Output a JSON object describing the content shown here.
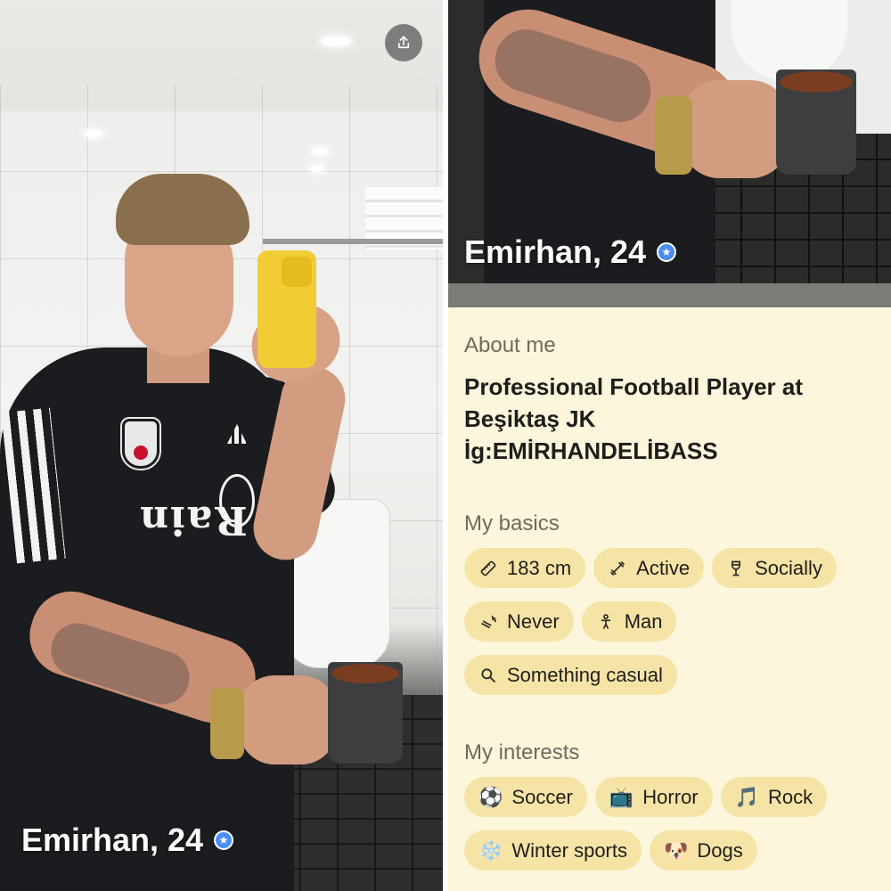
{
  "profile": {
    "name_age": "Emirhan, 24"
  },
  "about": {
    "title": "About me",
    "lines": [
      "Professional Football Player at",
      "Beşiktaş JK",
      "İg:EMİRHANDELİBASS"
    ]
  },
  "basics": {
    "title": "My basics",
    "items": [
      {
        "label": "183 cm",
        "icon": "ruler-icon"
      },
      {
        "label": "Active",
        "icon": "dumbbell-icon"
      },
      {
        "label": "Socially",
        "icon": "wine-glass-icon"
      },
      {
        "label": "Never",
        "icon": "smoking-icon"
      },
      {
        "label": "Man",
        "icon": "person-icon"
      },
      {
        "label": "Something casual",
        "icon": "magnifier-icon"
      }
    ]
  },
  "interests": {
    "title": "My interests",
    "items": [
      {
        "label": "Soccer",
        "emoji": "⚽"
      },
      {
        "label": "Horror",
        "emoji": "📺"
      },
      {
        "label": "Rock",
        "emoji": "🎵"
      },
      {
        "label": "Winter sports",
        "emoji": "❄️"
      },
      {
        "label": "Dogs",
        "emoji": "🐶"
      }
    ]
  },
  "photo": {
    "shirt_sponsor": "Rain"
  },
  "colors": {
    "panel_bg": "#fcf6dc",
    "chip_bg": "#f6e4a6",
    "verified": "#4a8df6"
  }
}
